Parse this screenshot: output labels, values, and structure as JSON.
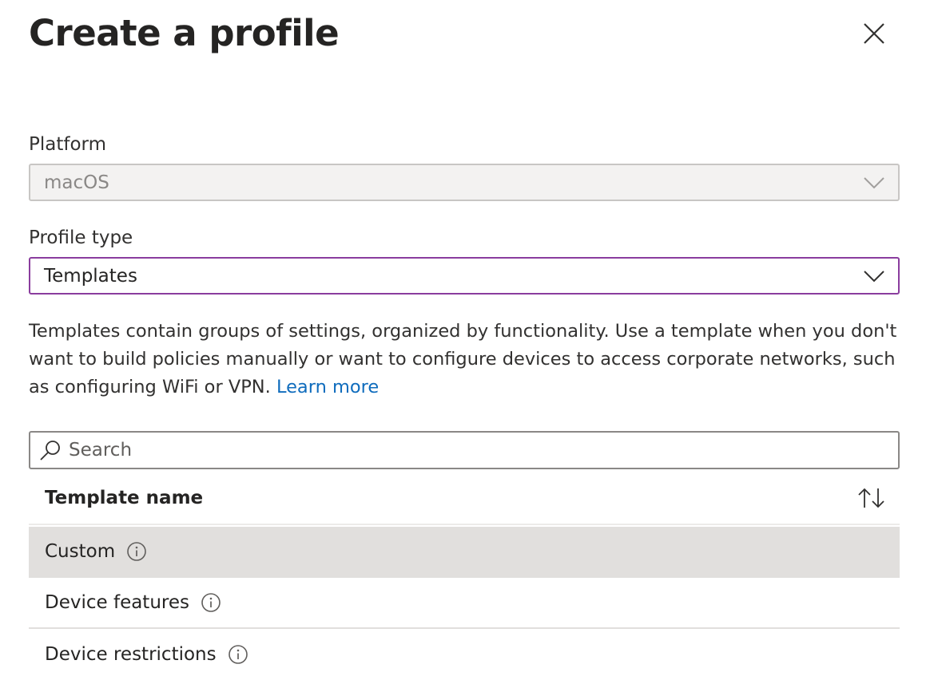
{
  "panel": {
    "title": "Create a profile",
    "close_icon": "close-icon"
  },
  "platform": {
    "label": "Platform",
    "value": "macOS",
    "disabled": true
  },
  "profile_type": {
    "label": "Profile type",
    "value": "Templates"
  },
  "description": {
    "text": "Templates contain groups of settings, organized by functionality. Use a template when you don't want to build policies manually or want to configure devices to access corporate networks, such as configuring WiFi or VPN.",
    "link": "Learn more"
  },
  "search": {
    "placeholder": "Search",
    "value": ""
  },
  "table": {
    "column_header": "Template name",
    "sort_icon": "sort-icon",
    "rows": [
      {
        "name": "Custom",
        "selected": true
      },
      {
        "name": "Device features",
        "selected": false
      },
      {
        "name": "Device restrictions",
        "selected": false
      }
    ]
  },
  "colors": {
    "accent_border": "#8a3d9e",
    "link": "#0f6cbd",
    "selected_row": "#e1dfdd"
  }
}
